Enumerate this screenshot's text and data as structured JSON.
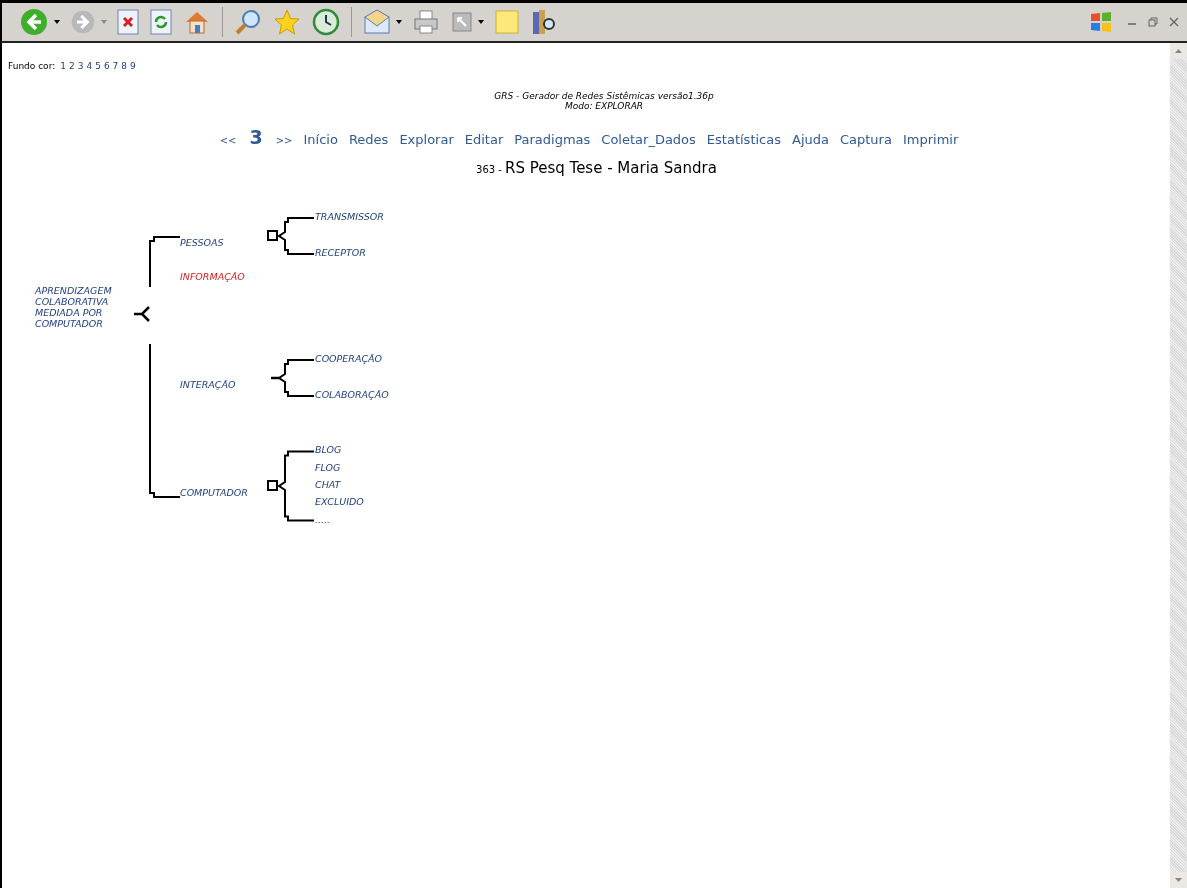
{
  "background_colors": {
    "label": "Fundo cor:",
    "options": [
      "1",
      "2",
      "3",
      "4",
      "5",
      "6",
      "7",
      "8",
      "9"
    ]
  },
  "header": {
    "title": "GRS - Gerador de Redes Sistêmicas versão1.36p",
    "mode": "Modo: EXPLORAR"
  },
  "nav": {
    "prev": "<<",
    "current": "3",
    "next": ">>",
    "links": [
      "Início",
      "Redes",
      "Explorar",
      "Editar",
      "Paradigmas",
      "Coletar_Dados",
      "Estatísticas",
      "Ajuda",
      "Captura",
      "Imprimir"
    ]
  },
  "network_title": {
    "number": "363 -",
    "name": "RS Pesq Tese - Maria Sandra"
  },
  "tree": {
    "label": "APRENDIZAGEM COLABORATIVA MEDIADA POR COMPUTADOR",
    "color": "#1f3f7f",
    "children": [
      {
        "label": "PESSOAS",
        "color": "#1f3f7f",
        "boxed": true,
        "children": [
          {
            "label": "TRANSMISSOR"
          },
          {
            "label": "RECEPTOR"
          }
        ]
      },
      {
        "label": "INFORMAÇÃO",
        "color": "#d42020"
      },
      {
        "label": "INTERAÇÃO",
        "color": "#1f3f7f",
        "boxed": false,
        "children": [
          {
            "label": "COOPERAÇÃO"
          },
          {
            "label": "COLABORAÇÃO"
          }
        ]
      },
      {
        "label": "COMPUTADOR",
        "color": "#1f3f7f",
        "boxed": true,
        "children": [
          {
            "label": "BLOG"
          },
          {
            "label": "FLOG"
          },
          {
            "label": "CHAT"
          },
          {
            "label": "EXCLUIDO"
          },
          {
            "label": "....."
          }
        ]
      }
    ]
  }
}
